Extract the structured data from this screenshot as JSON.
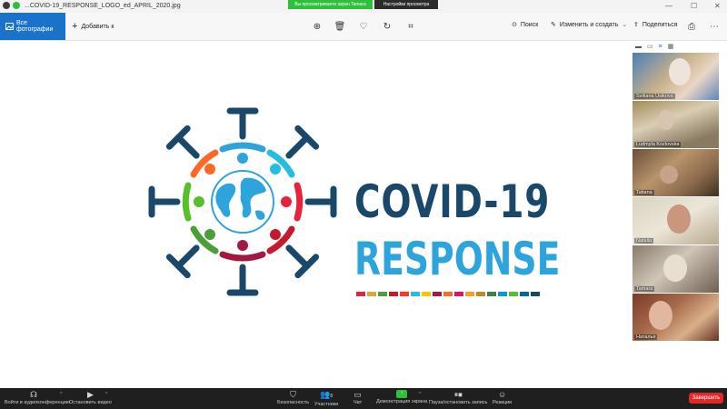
{
  "window": {
    "file_name": "...COVID-19_RESPONSE_LOGO_ed_APRIL_2020.jpg",
    "share_banner": "Вы просматриваете экран Tamara",
    "view_options": "Настройки просмотра"
  },
  "toolbar": {
    "all_photos": "Все фотографии",
    "add_to": "Добавить к",
    "search": "Поиск",
    "edit_create": "Изменить и создать",
    "share": "Поделиться"
  },
  "logo": {
    "line1": "COVID-19",
    "line2": "RESPONSE",
    "strip_colors": [
      "#e5243b",
      "#dda63a",
      "#4c9f38",
      "#c5192d",
      "#ff3a21",
      "#26bde2",
      "#fcc30b",
      "#a21942",
      "#fd6925",
      "#dd1367",
      "#fd9d24",
      "#bf8b2e",
      "#3f7e44",
      "#0a97d9",
      "#56c02b",
      "#00689d",
      "#19486a"
    ],
    "colors": {
      "dark_blue": "#19486a",
      "light_blue": "#2da4dc"
    }
  },
  "participants": [
    {
      "name": "Svitlana Usikova"
    },
    {
      "name": "Ludmyla Kozlovska"
    },
    {
      "name": "Tatiana"
    },
    {
      "name": "Natalia"
    },
    {
      "name": "Tamara"
    },
    {
      "name": "Наталья"
    }
  ],
  "zoom_bar": {
    "audio": "Войти в аудиоконференцию",
    "video": "Остановить видео",
    "security": "Безопасность",
    "participants": "Участники",
    "participants_count": "8",
    "chat": "Чат",
    "share_screen": "Демонстрация экрана",
    "record": "Пауза/остановить запись",
    "reactions": "Реакции",
    "end": "Завершить"
  },
  "accent_colors": {
    "zoom_green": "#2fbf3a",
    "photos_blue": "#1a73c9",
    "end_red": "#e02828"
  }
}
